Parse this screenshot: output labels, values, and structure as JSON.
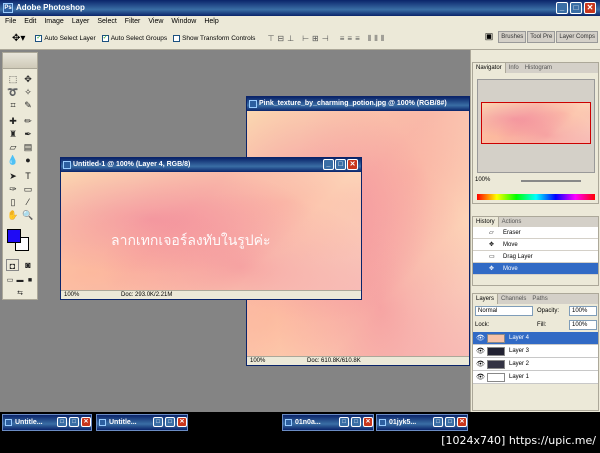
{
  "app": {
    "title": "Adobe Photoshop",
    "logo": "Ps"
  },
  "window_controls": {
    "minimize": "_",
    "maximize": "□",
    "close": "✕"
  },
  "menu": [
    "File",
    "Edit",
    "Image",
    "Layer",
    "Select",
    "Filter",
    "View",
    "Window",
    "Help"
  ],
  "options_bar": {
    "auto_select_layer": "Auto Select Layer",
    "auto_select_groups": "Auto Select Groups",
    "show_transform_controls": "Show Transform Controls",
    "palette_well": [
      "Brushes",
      "Tool Pre",
      "Layer Comps"
    ]
  },
  "doc_back": {
    "title": "Pink_texture_by_charming_potion.jpg @ 100% (RGB/8#)",
    "zoom": "100%",
    "doc_info": "Doc: 610.8K/610.8K"
  },
  "doc_front": {
    "title": "Untitled-1 @ 100% (Layer 4, RGB/8)",
    "canvas_text": "ลากเทกเจอร์ลงทับในรูปค่ะ",
    "zoom": "100%",
    "doc_info": "Doc: 293.0K/2.21M"
  },
  "navigator": {
    "tabs": [
      "Navigator",
      "Info",
      "Histogram"
    ],
    "zoom": "100%"
  },
  "history": {
    "tabs": [
      "History",
      "Actions"
    ],
    "items": [
      "Eraser",
      "Move",
      "Drag Layer",
      "Move"
    ],
    "selected_index": 3
  },
  "layers": {
    "tabs": [
      "Layers",
      "Channels",
      "Paths"
    ],
    "blend_mode": "Normal",
    "opacity_label": "Opacity:",
    "opacity": "100%",
    "lock_label": "Lock:",
    "fill_label": "Fill:",
    "fill": "100%",
    "items": [
      "Layer 4",
      "Layer 3",
      "Layer 2",
      "Layer 1"
    ],
    "selected_index": 0
  },
  "minimized_windows": [
    "Untitle...",
    "Untitle...",
    "01n0a...",
    "01jyk5..."
  ],
  "footer": "[1024x740] https://upic.me/",
  "colors": {
    "title_blue": "#0a246a",
    "selection_blue": "#316ac5",
    "workspace_gray": "#848484",
    "foreground": "#1f0bf5",
    "background": "#ffffff"
  }
}
